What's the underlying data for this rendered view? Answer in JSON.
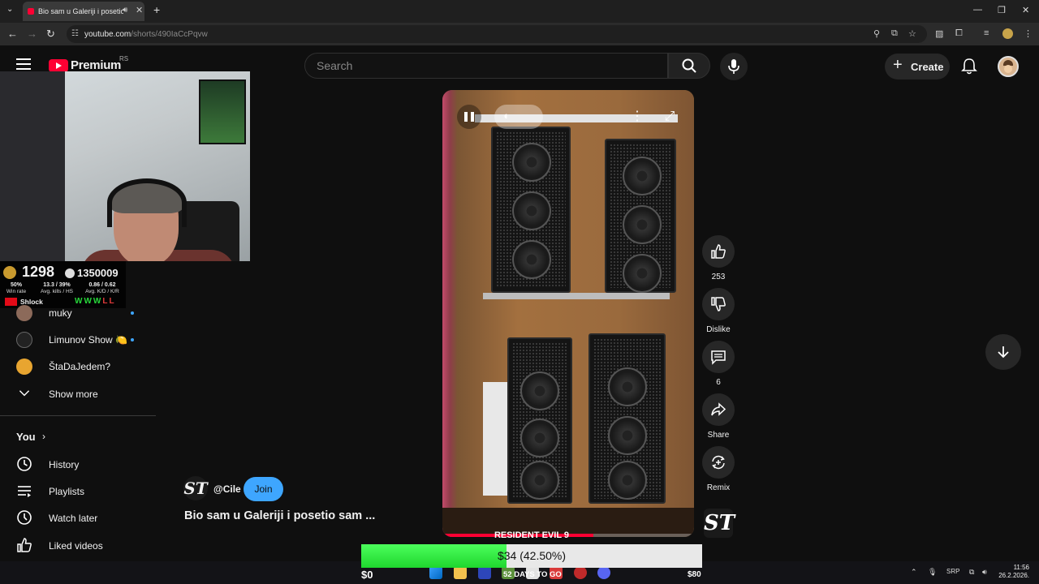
{
  "browser": {
    "tab_title": "Bio sam u Galeriji i posetio",
    "url_host": "youtube.com",
    "url_path": "/shorts/490IaCcPqvw",
    "window_controls": [
      "minimize-icon",
      "restore-icon",
      "close-icon"
    ]
  },
  "header": {
    "logo_text": "Premium",
    "country_code": "RS",
    "search_placeholder": "Search",
    "create_label": "Create"
  },
  "stream_overlay": {
    "elo": "1298",
    "points": "1350009",
    "stats": [
      {
        "value": "50%",
        "label": "Win rate"
      },
      {
        "value": "13.3 / 39%",
        "label": "Avg. kills / HS"
      },
      {
        "value": "0.86 / 0.62",
        "label": "Avg. K/D / K/R"
      }
    ],
    "player_name": "Shlock",
    "recent_results": [
      "W",
      "W",
      "W",
      "L",
      "L"
    ],
    "colors": {
      "win": "#27d83a",
      "loss": "#e23a3a",
      "rank": "#c99a2e"
    }
  },
  "sidebar": {
    "subscriptions": [
      {
        "name": "muky",
        "live_dot": true,
        "avatar_color": "#8c6a5a"
      },
      {
        "name": "Limunov Show 🍋",
        "live_dot": true,
        "avatar_color": "#222"
      },
      {
        "name": "ŠtaDaJedem?",
        "live_dot": false,
        "avatar_color": "#e8a530"
      }
    ],
    "show_more": "Show more",
    "you_heading": "You",
    "you_items": [
      {
        "label": "History",
        "icon": "history-icon"
      },
      {
        "label": "Playlists",
        "icon": "playlists-icon"
      },
      {
        "label": "Watch later",
        "icon": "watch-later-icon"
      },
      {
        "label": "Liked videos",
        "icon": "liked-videos-icon"
      }
    ]
  },
  "short": {
    "channel_handle": "@Cile",
    "channel_logo_text": "ST",
    "join_label": "Join",
    "title": "Bio sam u Galeriji i posetio sam ...",
    "progress": 0.6,
    "actions": {
      "like_count": "253",
      "dislike_label": "Dislike",
      "comment_count": "6",
      "share_label": "Share",
      "remix_label": "Remix"
    }
  },
  "goal": {
    "label": "RESIDENT EVIL 9",
    "progress_text": "$34 (42.50%)",
    "progress": 0.425,
    "min": "$0",
    "max": "$80",
    "days": "52 DAYS TO GO"
  },
  "taskbar": {
    "lang": "SRP",
    "time": "11:56",
    "date": "26.2.2026."
  }
}
